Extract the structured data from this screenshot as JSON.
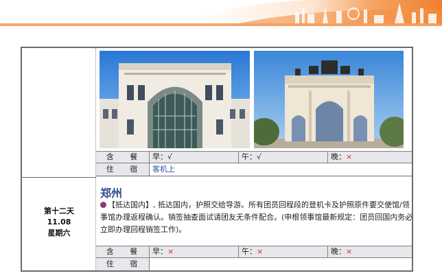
{
  "day11": {
    "meals": {
      "label": "含 餐",
      "breakfast": "早：√",
      "lunch": "午：√",
      "dinner_prefix": "晚：",
      "dinner_mark": "×"
    },
    "lodging": {
      "label": "住 宿",
      "value": "客机上"
    }
  },
  "day12": {
    "day_label": "第十二天",
    "date": "11.08",
    "weekday": "星期六",
    "city": "郑州",
    "description_tag": "【抵达国内】",
    "description": ", 抵达国内，护照交给导游。所有团员回程段的登机卡及护照原件要交使馆/领事馆办理返程确认。销签抽查面试请团友无条件配合。(申根领事馆最新规定：团员回国内务必立即办理回程销签工作)。",
    "meals": {
      "label": "含 餐",
      "breakfast_prefix": "早：",
      "lunch_prefix": "午：",
      "dinner_prefix": "晚：",
      "mark": "×"
    },
    "lodging": {
      "label": "住 宿",
      "value": ""
    }
  },
  "colors": {
    "accent_orange": "#f08a3c",
    "title_blue": "#2c4a8c",
    "cross_red": "#e0271c",
    "bullet_purple": "#8a3a7a"
  },
  "icons": {
    "bullet": "purple-circle",
    "banner": "skyline-silhouette"
  }
}
